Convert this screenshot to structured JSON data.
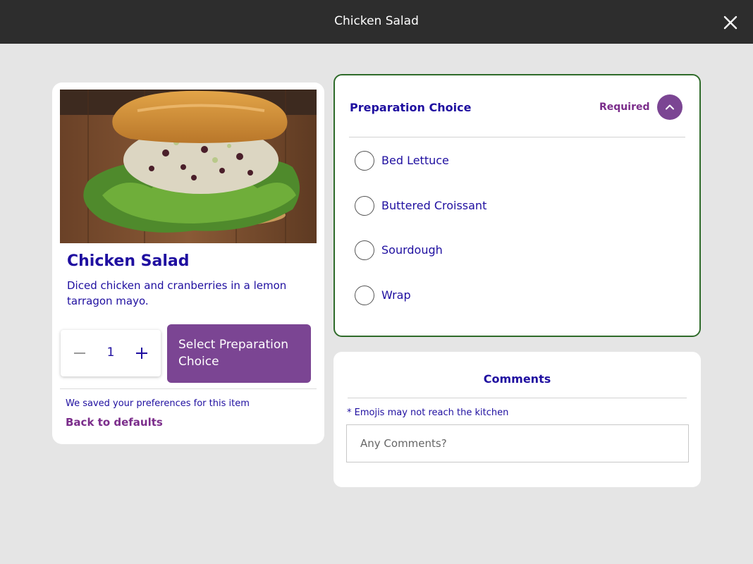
{
  "header": {
    "title": "Chicken Salad"
  },
  "item": {
    "name": "Chicken Salad",
    "description": "Diced chicken and cranberries in a lemon tarragon mayo.",
    "quantity": "1",
    "select_button_label": "Select Preparation Choice",
    "saved_note": "We saved your preferences for this item",
    "back_to_defaults_label": "Back to defaults"
  },
  "preparation": {
    "title": "Preparation Choice",
    "required_label": "Required",
    "options": [
      {
        "label": "Bed Lettuce"
      },
      {
        "label": "Buttered Croissant"
      },
      {
        "label": "Sourdough"
      },
      {
        "label": "Wrap"
      }
    ]
  },
  "comments": {
    "title": "Comments",
    "note": "* Emojis may not reach the kitchen",
    "placeholder": "Any Comments?"
  },
  "colors": {
    "accent": "#7b4593",
    "text_primary": "#1f0fa0",
    "panel_border": "#2f6b2a",
    "topbar": "#2d2d2d"
  }
}
